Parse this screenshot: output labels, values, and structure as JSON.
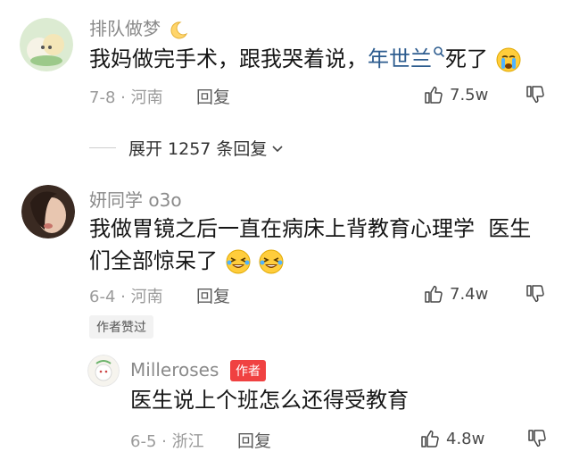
{
  "comment1": {
    "username": "排队做梦",
    "text_main": "我妈做完手术，跟我哭着说，",
    "text_link": "年世兰",
    "text_tail": "死了",
    "date": "7-8 · 河南",
    "reply_label": "回复",
    "likes": "7.5w"
  },
  "expand": {
    "label": "展开 1257 条回复"
  },
  "comment2": {
    "username": "妍同学 o3o",
    "text_line1": "我做胃镜之后一直在病床上背教育心理学  医生",
    "text_line2": "们全部惊呆了",
    "date": "6-4 · 河南",
    "reply_label": "回复",
    "likes": "7.4w",
    "author_liked_tag": "作者赞过"
  },
  "reply1": {
    "username": "Milleroses",
    "badge": "作者",
    "text": "医生说上个班怎么还得受教育",
    "date": "6-5 · 浙江",
    "reply_label": "回复",
    "likes": "4.8w"
  },
  "colors": {
    "link": "#2d5c8f",
    "badge": "#f04141",
    "meta": "#9a9a9a"
  },
  "icons": [
    "thumbs-up-icon",
    "thumbs-down-icon",
    "chevron-down-icon",
    "search-icon",
    "emoji-crying-icon",
    "emoji-laughing-icon"
  ]
}
